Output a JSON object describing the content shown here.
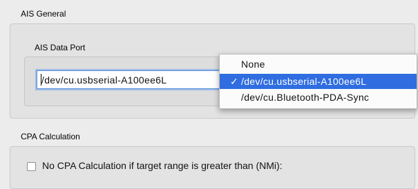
{
  "ais_general": {
    "title": "AIS General",
    "data_port": {
      "label": "AIS Data Port",
      "value": "/dev/cu.usbserial-A100ee6L",
      "options": [
        {
          "label": "None",
          "selected": false
        },
        {
          "label": "/dev/cu.usbserial-A100ee6L",
          "selected": true
        },
        {
          "label": "/dev/cu.Bluetooth-PDA-Sync",
          "selected": false
        }
      ],
      "check_mark": "✓"
    }
  },
  "cpa": {
    "title": "CPA Calculation",
    "no_cpa_checkbox_label": "No CPA Calculation if target range is greater than (NMi):",
    "no_cpa_checked": false
  },
  "colors": {
    "selection": "#2f6de0",
    "focus_ring": "#9dbcea"
  }
}
